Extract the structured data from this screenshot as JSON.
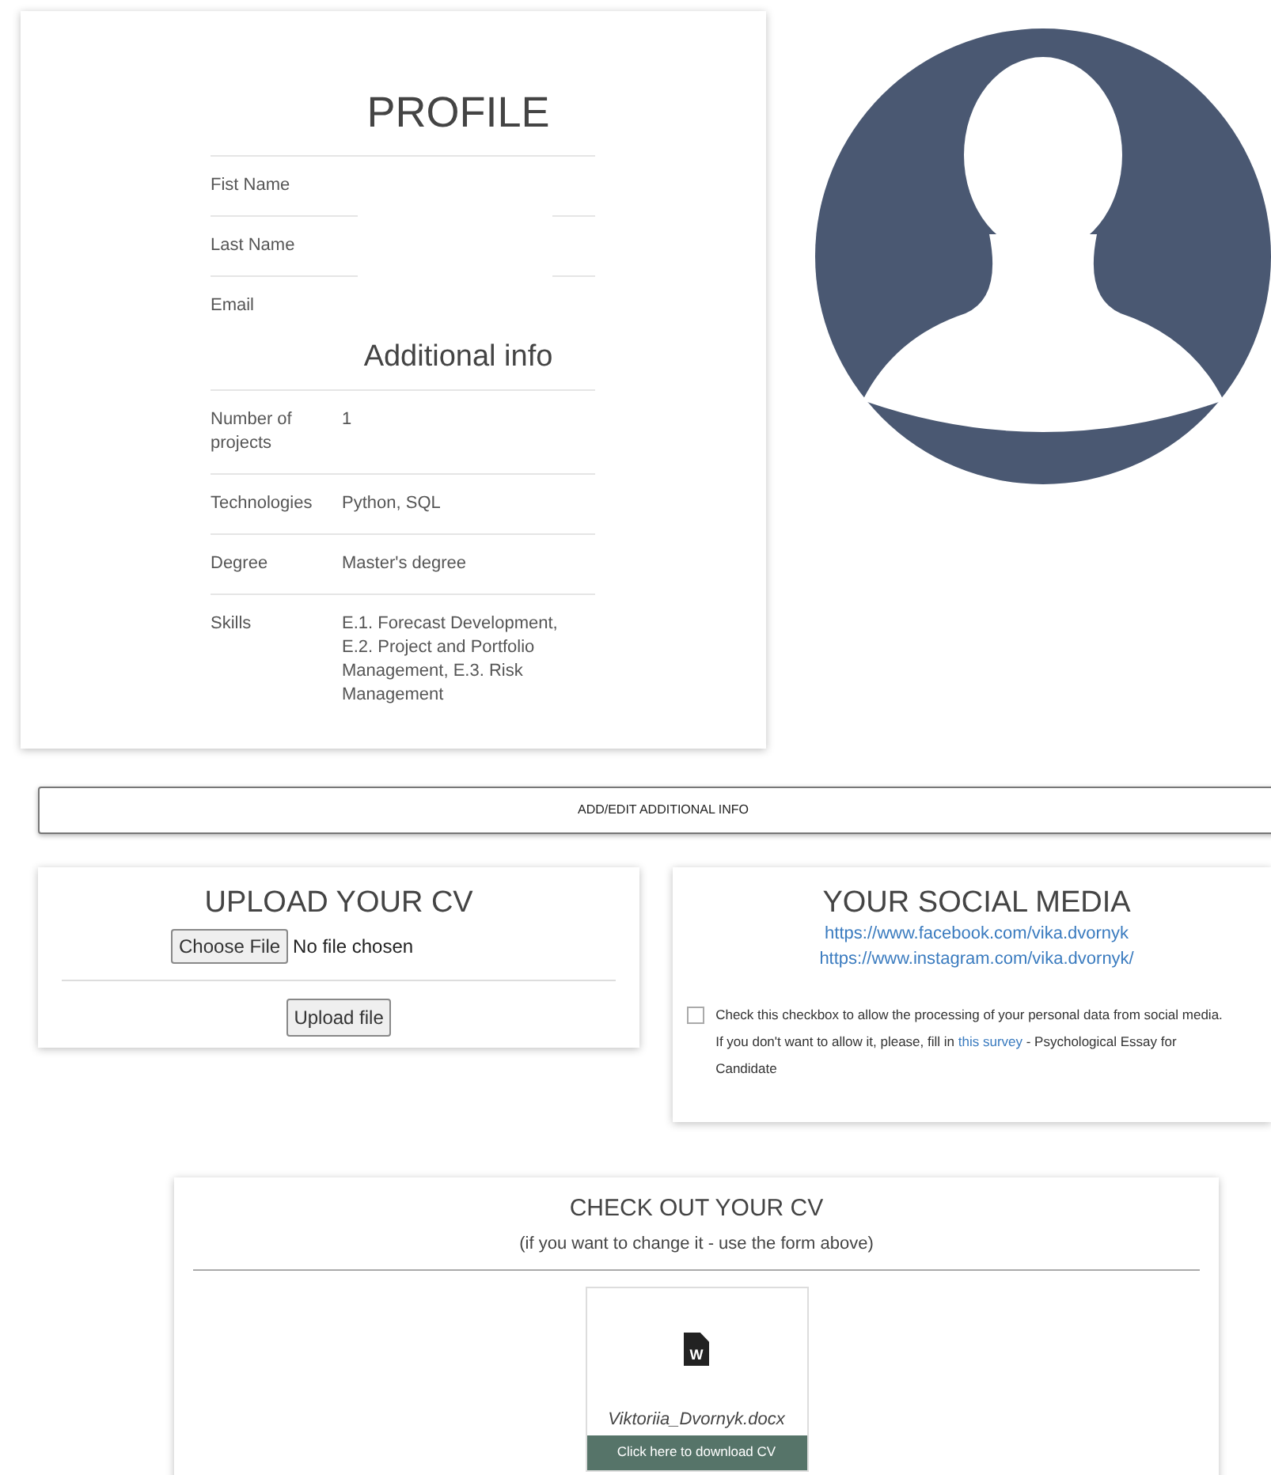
{
  "profile": {
    "title": "PROFILE",
    "fields": [
      {
        "label": "Fist Name"
      },
      {
        "label": "Last Name"
      },
      {
        "label": "Email"
      }
    ],
    "additional_title": "Additional info",
    "additional": [
      {
        "label": "Number of projects",
        "value": "1"
      },
      {
        "label": "Technologies",
        "value": "Python, SQL"
      },
      {
        "label": "Degree",
        "value": "Master's degree"
      },
      {
        "label": "Skills",
        "value": "E.1. Forecast Development, E.2. Project and Portfolio Management, E.3. Risk Management"
      }
    ]
  },
  "add_edit_button": "ADD/EDIT ADDITIONAL INFO",
  "upload": {
    "title": "UPLOAD YOUR CV",
    "choose_button": "Choose File",
    "file_status": "No file chosen",
    "upload_button": "Upload file"
  },
  "social": {
    "title": "YOUR SOCIAL MEDIA",
    "links": [
      "https://www.facebook.com/vika.dvornyk",
      "https://www.instagram.com/vika.dvornyk/"
    ],
    "consent": {
      "checked": false,
      "before": "Check this checkbox to allow the processing of your personal data from social media. If you don't want to allow it, please, fill in ",
      "link": "this survey",
      "after": " - Psychological Essay for Candidate"
    }
  },
  "cv": {
    "title": "CHECK OUT YOUR CV",
    "subtitle": "(if you want to change it - use the form above)",
    "icon_letter": "W",
    "file_name": "Viktoriia_Dvornyk.docx",
    "download_button": "Click here to download CV"
  }
}
